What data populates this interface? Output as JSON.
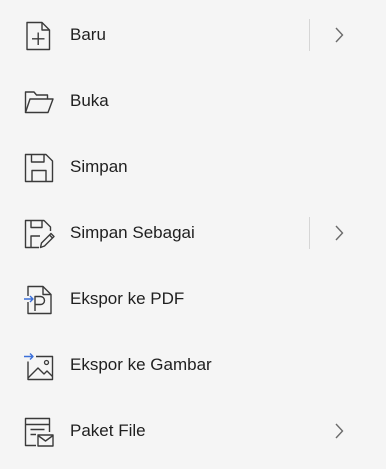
{
  "menu": {
    "items": [
      {
        "label": "Baru",
        "icon": "new-file-icon",
        "has_submenu": true,
        "has_divider": true
      },
      {
        "label": "Buka",
        "icon": "open-folder-icon",
        "has_submenu": false,
        "has_divider": false
      },
      {
        "label": "Simpan",
        "icon": "save-icon",
        "has_submenu": false,
        "has_divider": false
      },
      {
        "label": "Simpan Sebagai",
        "icon": "save-as-icon",
        "has_submenu": true,
        "has_divider": true
      },
      {
        "label": "Ekspor ke PDF",
        "icon": "export-pdf-icon",
        "has_submenu": false,
        "has_divider": false
      },
      {
        "label": "Ekspor ke Gambar",
        "icon": "export-image-icon",
        "has_submenu": false,
        "has_divider": false
      },
      {
        "label": "Paket File",
        "icon": "package-file-icon",
        "has_submenu": true,
        "has_divider": false
      }
    ]
  },
  "colors": {
    "background": "#f5f5f5",
    "text": "#1f1f1f",
    "icon_stroke": "#3a3a3a",
    "accent_arrow": "#3b6fd8",
    "divider": "#d6d6d6",
    "chevron": "#6b6b6b"
  }
}
